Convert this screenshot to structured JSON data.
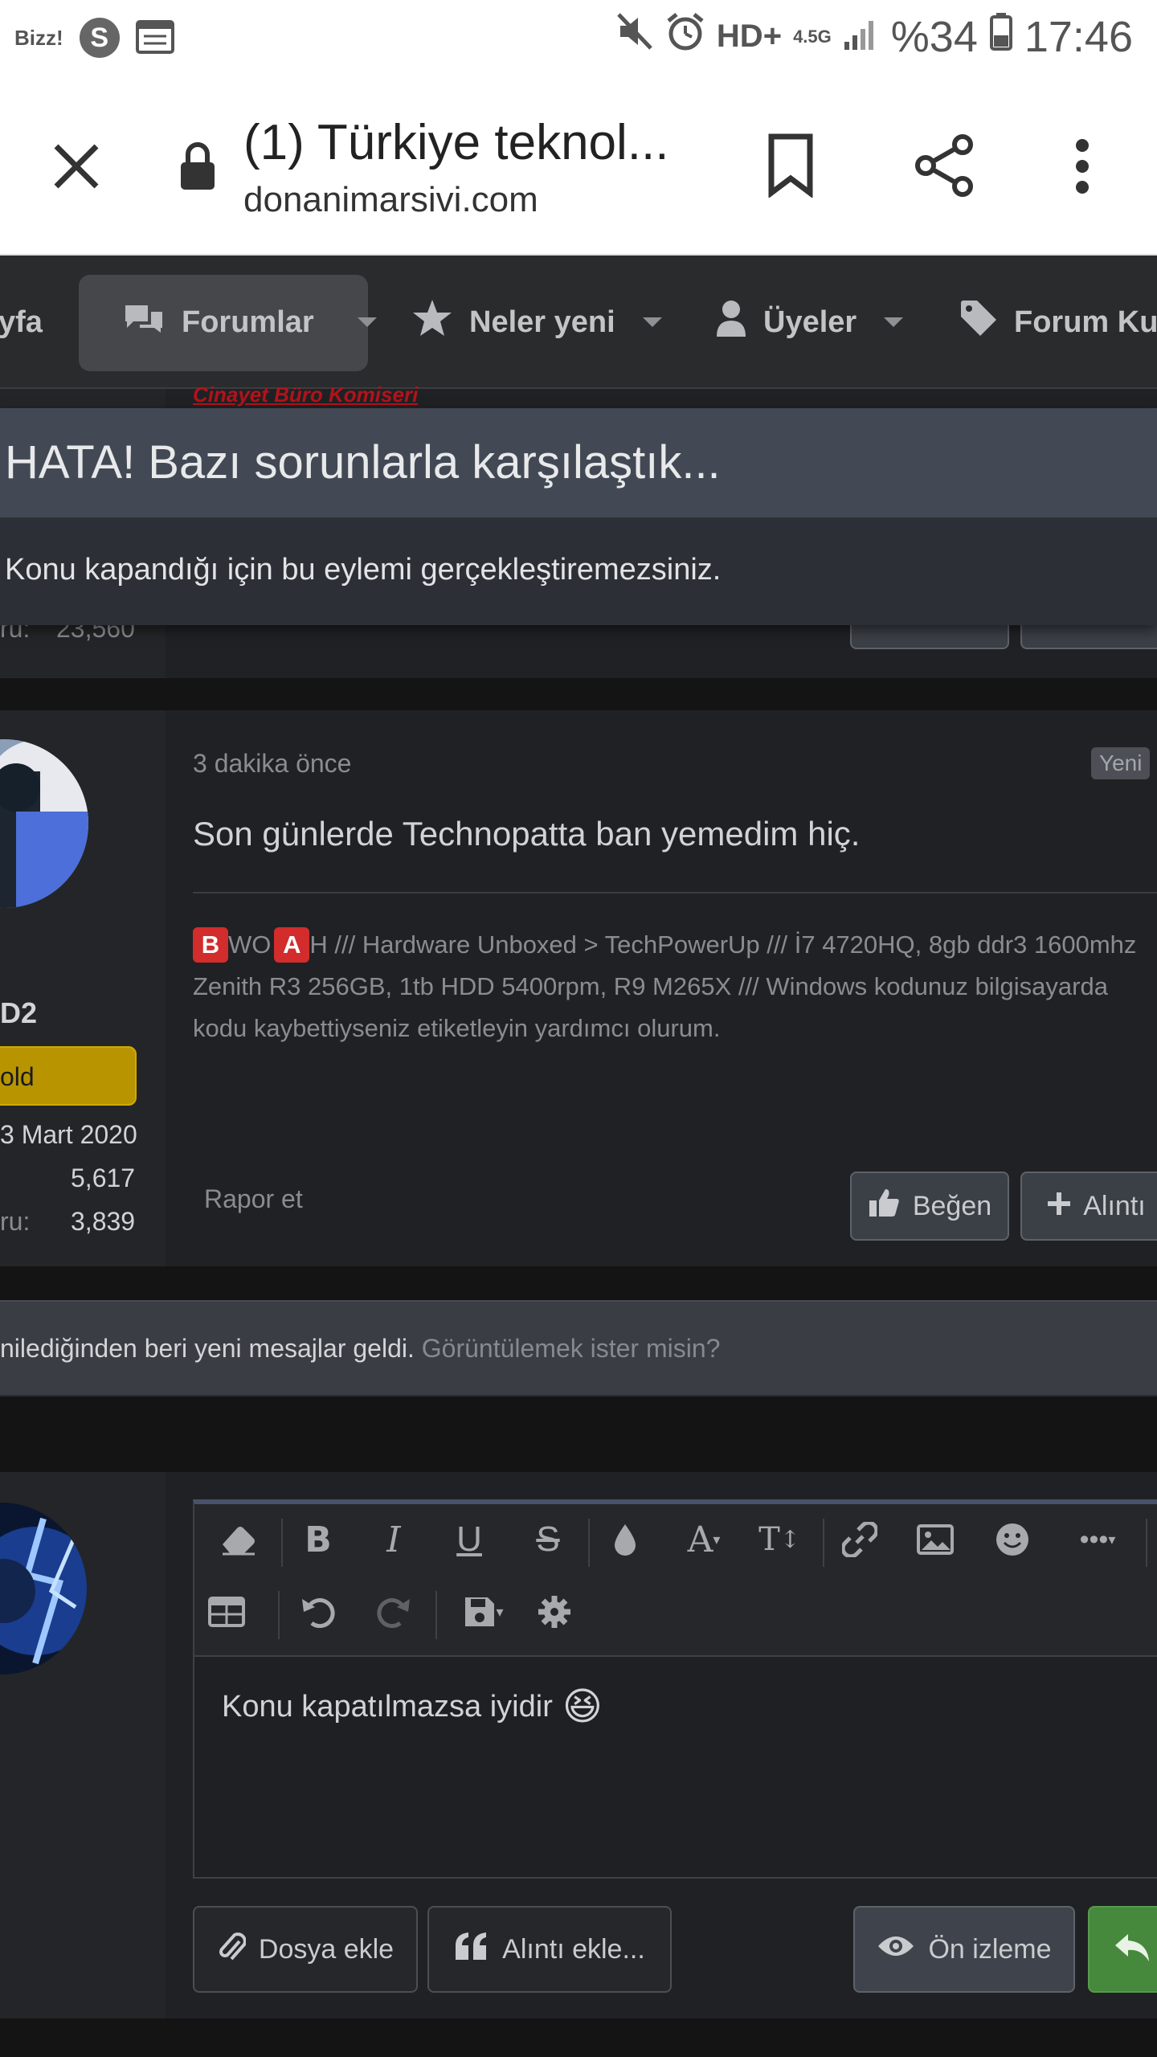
{
  "status_bar": {
    "carrier": "Bizz!",
    "s_icon": "S",
    "network": "HD+",
    "network_small": "4.5G",
    "battery": "%34",
    "time": "17:46",
    "icons": [
      "mute-icon",
      "alarm-icon",
      "signal-icon",
      "battery-icon",
      "calendar-icon"
    ]
  },
  "browser": {
    "tab_title": "(1) Türkiye teknol...",
    "url": "donanimarsivi.com",
    "icons": [
      "close-icon",
      "lock-icon",
      "bookmark-icon",
      "share-icon",
      "more-icon"
    ]
  },
  "nav": {
    "items": [
      {
        "label": "yfa"
      },
      {
        "label": "Forumlar"
      },
      {
        "label": "Neler yeni"
      },
      {
        "label": "Üyeler"
      },
      {
        "label": "Forum Kur"
      }
    ]
  },
  "prev_post": {
    "user_title": "Cinayet Büro Komiseri",
    "stat_label": "ru:",
    "stat_value": "23,560"
  },
  "error_dialog": {
    "title": "HATA! Bazı sorunlarla karşılaştık...",
    "message": "Konu kapandığı için bu eylemi gerçekleştiremezsiniz."
  },
  "post": {
    "time": "3 dakika önce",
    "new_badge": "Yeni",
    "body": "Son günlerde Technopatta ban yemedim hiç.",
    "signature": {
      "b": "B",
      "wo": "WO",
      "a": "A",
      "h_line": "H /// Hardware Unboxed > TechPowerUp /// İ7 4720HQ, 8gb ddr3 1600mhz",
      "line2": "Zenith R3 256GB, 1tb HDD 5400rpm, R9 M265X /// Windows kodunuz bilgisayarda",
      "line3": "kodu kaybettiyseniz etiketleyin yardımcı olurum."
    },
    "user": {
      "name_fragment": "D2",
      "rank": "old",
      "joined": "3 Mart 2020",
      "messages": "5,617",
      "reaction_label": "ru:",
      "reaction_value": "3,839"
    },
    "report": "Rapor et",
    "like": "Beğen",
    "quote": "Alıntı"
  },
  "new_messages_bar": {
    "text": "nilediğinden beri yeni mesajlar geldi.",
    "link": "Görüntülemek ister misin?"
  },
  "editor": {
    "content": "Konu kapatılmazsa iyidir",
    "emoji": "😆",
    "toolbar_icons": [
      "eraser-icon",
      "bold-icon",
      "italic-icon",
      "underline-icon",
      "strikethrough-icon",
      "color-drop-icon",
      "font-family-icon",
      "font-size-icon",
      "link-icon",
      "image-icon",
      "smiley-icon",
      "more-options-icon",
      "table-icon",
      "undo-icon",
      "redo-icon",
      "save-draft-icon",
      "settings-icon"
    ]
  },
  "actions": {
    "attach": "Dosya ekle",
    "insert_quote": "Alıntı ekle...",
    "preview": "Ön izleme"
  }
}
